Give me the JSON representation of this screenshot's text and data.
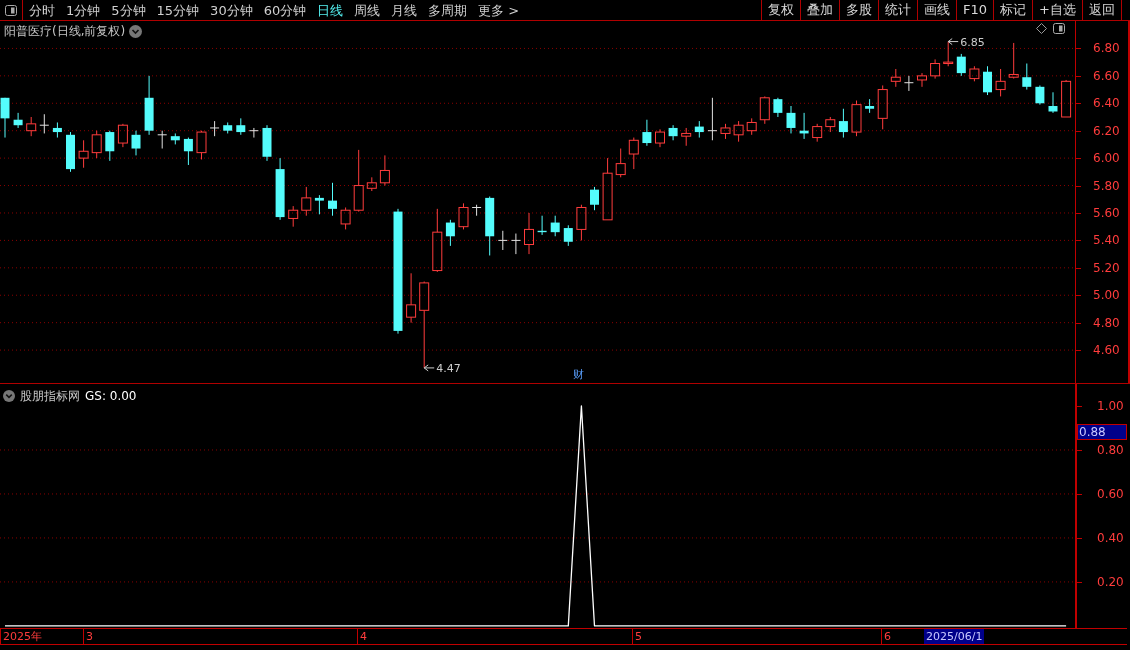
{
  "toolbar": {
    "periods": [
      {
        "label": "分时",
        "selected": false
      },
      {
        "label": "1分钟",
        "selected": false
      },
      {
        "label": "5分钟",
        "selected": false
      },
      {
        "label": "15分钟",
        "selected": false
      },
      {
        "label": "30分钟",
        "selected": false
      },
      {
        "label": "60分钟",
        "selected": false
      },
      {
        "label": "日线",
        "selected": true
      },
      {
        "label": "周线",
        "selected": false
      },
      {
        "label": "月线",
        "selected": false
      },
      {
        "label": "多周期",
        "selected": false
      },
      {
        "label": "更多 >",
        "selected": false
      }
    ],
    "buttons": [
      "复权",
      "叠加",
      "多股",
      "统计",
      "画线",
      "F10",
      "标记",
      "+自选",
      "返回"
    ]
  },
  "main_chart": {
    "title": "阳普医疗(日线,前复权)",
    "high_label": "6.85",
    "low_label": "4.47",
    "finance_marker": "财",
    "chart_data": {
      "type": "candlestick",
      "ohlc": [
        [
          6.44,
          6.44,
          6.15,
          6.29
        ],
        [
          6.28,
          6.33,
          6.22,
          6.24
        ],
        [
          6.2,
          6.3,
          6.16,
          6.25
        ],
        [
          6.24,
          6.32,
          6.18,
          6.24
        ],
        [
          6.22,
          6.26,
          6.15,
          6.19
        ],
        [
          6.17,
          6.19,
          5.9,
          5.92
        ],
        [
          6.0,
          6.13,
          5.93,
          6.05
        ],
        [
          6.04,
          6.2,
          6.0,
          6.17
        ],
        [
          6.19,
          6.2,
          5.98,
          6.05
        ],
        [
          6.11,
          6.25,
          6.08,
          6.24
        ],
        [
          6.17,
          6.2,
          6.02,
          6.07
        ],
        [
          6.44,
          6.6,
          6.17,
          6.2
        ],
        [
          6.17,
          6.2,
          6.07,
          6.17
        ],
        [
          6.16,
          6.18,
          6.1,
          6.13
        ],
        [
          6.14,
          6.15,
          5.95,
          6.05
        ],
        [
          6.04,
          6.2,
          5.99,
          6.19
        ],
        [
          6.22,
          6.27,
          6.16,
          6.22
        ],
        [
          6.24,
          6.26,
          6.18,
          6.2
        ],
        [
          6.24,
          6.29,
          6.17,
          6.19
        ],
        [
          6.2,
          6.22,
          6.15,
          6.2
        ],
        [
          6.22,
          6.24,
          5.98,
          6.01
        ],
        [
          5.92,
          6.0,
          5.55,
          5.57
        ],
        [
          5.56,
          5.65,
          5.5,
          5.62
        ],
        [
          5.62,
          5.79,
          5.58,
          5.71
        ],
        [
          5.71,
          5.73,
          5.59,
          5.69
        ],
        [
          5.69,
          5.82,
          5.58,
          5.63
        ],
        [
          5.52,
          5.64,
          5.48,
          5.62
        ],
        [
          5.62,
          6.06,
          5.61,
          5.8
        ],
        [
          5.78,
          5.86,
          5.76,
          5.82
        ],
        [
          5.82,
          6.02,
          5.8,
          5.91
        ],
        [
          5.61,
          5.63,
          4.72,
          4.74
        ],
        [
          4.84,
          5.16,
          4.8,
          4.93
        ],
        [
          4.89,
          5.1,
          4.47,
          5.09
        ],
        [
          5.18,
          5.63,
          5.17,
          5.46
        ],
        [
          5.53,
          5.55,
          5.36,
          5.43
        ],
        [
          5.5,
          5.67,
          5.48,
          5.64
        ],
        [
          5.64,
          5.66,
          5.58,
          5.64
        ],
        [
          5.71,
          5.72,
          5.29,
          5.43
        ],
        [
          5.4,
          5.47,
          5.33,
          5.4
        ],
        [
          5.4,
          5.45,
          5.3,
          5.4
        ],
        [
          5.37,
          5.6,
          5.3,
          5.48
        ],
        [
          5.47,
          5.58,
          5.44,
          5.46
        ],
        [
          5.53,
          5.58,
          5.43,
          5.46
        ],
        [
          5.49,
          5.51,
          5.36,
          5.39
        ],
        [
          5.48,
          5.66,
          5.4,
          5.64
        ],
        [
          5.77,
          5.79,
          5.62,
          5.66
        ],
        [
          5.55,
          6.0,
          5.55,
          5.89
        ],
        [
          5.88,
          6.07,
          5.86,
          5.96
        ],
        [
          6.03,
          6.15,
          5.92,
          6.13
        ],
        [
          6.19,
          6.28,
          6.09,
          6.11
        ],
        [
          6.11,
          6.21,
          6.08,
          6.19
        ],
        [
          6.22,
          6.24,
          6.13,
          6.16
        ],
        [
          6.16,
          6.22,
          6.09,
          6.18
        ],
        [
          6.23,
          6.27,
          6.15,
          6.19
        ],
        [
          6.2,
          6.44,
          6.13,
          6.2
        ],
        [
          6.18,
          6.25,
          6.14,
          6.22
        ],
        [
          6.17,
          6.27,
          6.12,
          6.24
        ],
        [
          6.2,
          6.29,
          6.17,
          6.26
        ],
        [
          6.28,
          6.45,
          6.25,
          6.44
        ],
        [
          6.43,
          6.44,
          6.3,
          6.33
        ],
        [
          6.33,
          6.38,
          6.18,
          6.22
        ],
        [
          6.2,
          6.33,
          6.14,
          6.18
        ],
        [
          6.15,
          6.25,
          6.12,
          6.23
        ],
        [
          6.23,
          6.3,
          6.19,
          6.28
        ],
        [
          6.27,
          6.36,
          6.15,
          6.19
        ],
        [
          6.19,
          6.42,
          6.16,
          6.39
        ],
        [
          6.38,
          6.43,
          6.33,
          6.36
        ],
        [
          6.29,
          6.53,
          6.21,
          6.5
        ],
        [
          6.56,
          6.65,
          6.52,
          6.59
        ],
        [
          6.55,
          6.6,
          6.49,
          6.55
        ],
        [
          6.57,
          6.62,
          6.52,
          6.6
        ],
        [
          6.6,
          6.72,
          6.58,
          6.69
        ],
        [
          6.69,
          6.85,
          6.67,
          6.7
        ],
        [
          6.74,
          6.76,
          6.6,
          6.62
        ],
        [
          6.58,
          6.67,
          6.56,
          6.65
        ],
        [
          6.63,
          6.67,
          6.46,
          6.48
        ],
        [
          6.5,
          6.65,
          6.45,
          6.56
        ],
        [
          6.59,
          6.84,
          6.58,
          6.61
        ],
        [
          6.59,
          6.69,
          6.5,
          6.52
        ],
        [
          6.52,
          6.53,
          6.39,
          6.4
        ],
        [
          6.38,
          6.48,
          6.33,
          6.34
        ],
        [
          6.3,
          6.57,
          6.3,
          6.56
        ]
      ],
      "yticks": [
        {
          "value": 6.8,
          "label": "6.80"
        },
        {
          "value": 6.6,
          "label": "6.60"
        },
        {
          "value": 6.4,
          "label": "6.40"
        },
        {
          "value": 6.2,
          "label": "6.20"
        },
        {
          "value": 6.0,
          "label": "6.00"
        },
        {
          "value": 5.8,
          "label": "5.80"
        },
        {
          "value": 5.6,
          "label": "5.60"
        },
        {
          "value": 5.4,
          "label": "5.40"
        },
        {
          "value": 5.2,
          "label": "5.20"
        },
        {
          "value": 5.0,
          "label": "5.00"
        },
        {
          "value": 4.8,
          "label": "4.80"
        },
        {
          "value": 4.6,
          "label": "4.60"
        }
      ],
      "ylim": [
        4.36,
        7.0
      ],
      "grid": true
    }
  },
  "indicator": {
    "name": "股朋指标网",
    "reading": "GS: 0.00",
    "cursor_value": "0.88",
    "chart_data": {
      "type": "line",
      "series": [
        {
          "color": "#ffffff",
          "values": [
            0,
            0,
            0,
            0,
            0,
            0,
            0,
            0,
            0,
            0,
            0,
            0,
            0,
            0,
            0,
            0,
            0,
            0,
            0,
            0,
            0,
            0,
            0,
            0,
            0,
            0,
            0,
            0,
            0,
            0,
            0,
            0,
            0,
            0,
            0,
            0,
            0,
            0,
            0,
            0,
            0,
            0,
            0,
            0,
            1,
            0,
            0,
            0,
            0,
            0,
            0,
            0,
            0,
            0,
            0,
            0,
            0,
            0,
            0,
            0,
            0,
            0,
            0,
            0,
            0,
            0,
            0,
            0,
            0,
            0,
            0,
            0,
            0,
            0,
            0,
            0,
            0,
            0,
            0,
            0,
            0,
            0
          ]
        }
      ],
      "ylim": [
        -0.014,
        1.1
      ],
      "grid": true,
      "yticks": [
        {
          "value": 1,
          "label": "1.00"
        },
        {
          "value": 0.8,
          "label": "0.80"
        },
        {
          "value": 0.6,
          "label": "0.60"
        },
        {
          "value": 0.4,
          "label": "0.40"
        },
        {
          "value": 0.2,
          "label": "0.20"
        }
      ]
    }
  },
  "date_axis": {
    "labels": [
      "2025年",
      "3",
      "4",
      "5",
      "6"
    ],
    "cursor_date": "2025/06/1"
  }
}
